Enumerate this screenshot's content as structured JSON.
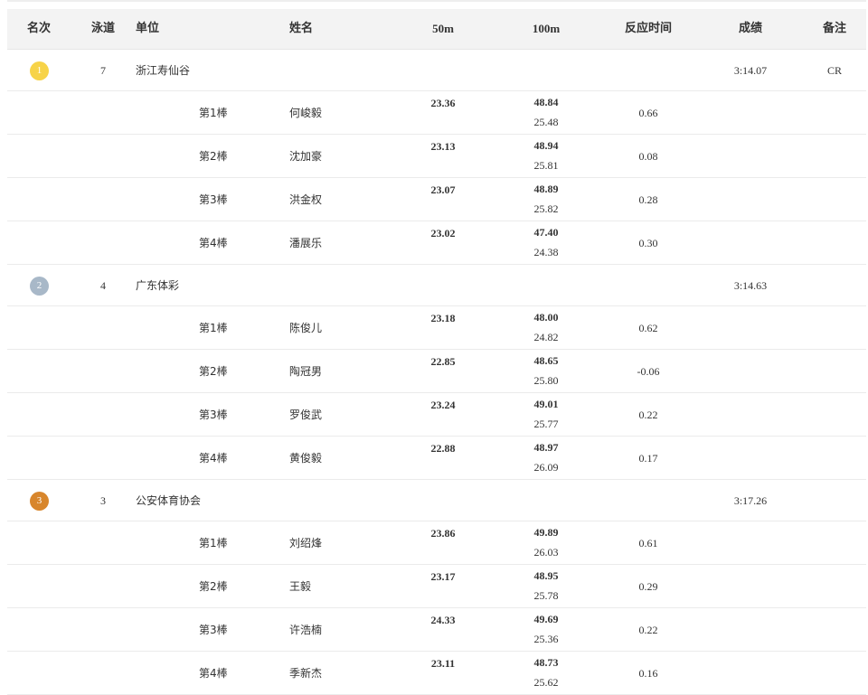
{
  "header": {
    "rank": "名次",
    "lane": "泳道",
    "unit": "单位",
    "name": "姓名",
    "split50": "50m",
    "split100": "100m",
    "reaction": "反应时间",
    "result": "成绩",
    "note": "备注"
  },
  "colors": {
    "gold": "#f7d348",
    "silver": "#a8b8c8",
    "bronze": "#d8862c"
  },
  "teams": [
    {
      "rank": "1",
      "medal": "gold",
      "lane": "7",
      "unit": "浙江寿仙谷",
      "result": "3:14.07",
      "note": "CR",
      "swimmers": [
        {
          "leg": "第1棒",
          "name": "何峻毅",
          "s50": "23.36",
          "s100": "48.84",
          "lap": "25.48",
          "rt": "0.66"
        },
        {
          "leg": "第2棒",
          "name": "沈加豪",
          "s50": "23.13",
          "s100": "48.94",
          "lap": "25.81",
          "rt": "0.08"
        },
        {
          "leg": "第3棒",
          "name": "洪金权",
          "s50": "23.07",
          "s100": "48.89",
          "lap": "25.82",
          "rt": "0.28"
        },
        {
          "leg": "第4棒",
          "name": "潘展乐",
          "s50": "23.02",
          "s100": "47.40",
          "lap": "24.38",
          "rt": "0.30"
        }
      ]
    },
    {
      "rank": "2",
      "medal": "silver",
      "lane": "4",
      "unit": "广东体彩",
      "result": "3:14.63",
      "note": "",
      "swimmers": [
        {
          "leg": "第1棒",
          "name": "陈俊儿",
          "s50": "23.18",
          "s100": "48.00",
          "lap": "24.82",
          "rt": "0.62"
        },
        {
          "leg": "第2棒",
          "name": "陶冠男",
          "s50": "22.85",
          "s100": "48.65",
          "lap": "25.80",
          "rt": "-0.06"
        },
        {
          "leg": "第3棒",
          "name": "罗俊武",
          "s50": "23.24",
          "s100": "49.01",
          "lap": "25.77",
          "rt": "0.22"
        },
        {
          "leg": "第4棒",
          "name": "黄俊毅",
          "s50": "22.88",
          "s100": "48.97",
          "lap": "26.09",
          "rt": "0.17"
        }
      ]
    },
    {
      "rank": "3",
      "medal": "bronze",
      "lane": "3",
      "unit": "公安体育协会",
      "result": "3:17.26",
      "note": "",
      "swimmers": [
        {
          "leg": "第1棒",
          "name": "刘绍烽",
          "s50": "23.86",
          "s100": "49.89",
          "lap": "26.03",
          "rt": "0.61"
        },
        {
          "leg": "第2棒",
          "name": "王毅",
          "s50": "23.17",
          "s100": "48.95",
          "lap": "25.78",
          "rt": "0.29"
        },
        {
          "leg": "第3棒",
          "name": "许浩楠",
          "s50": "24.33",
          "s100": "49.69",
          "lap": "25.36",
          "rt": "0.22"
        },
        {
          "leg": "第4棒",
          "name": "季新杰",
          "s50": "23.11",
          "s100": "48.73",
          "lap": "25.62",
          "rt": "0.16"
        }
      ]
    }
  ]
}
